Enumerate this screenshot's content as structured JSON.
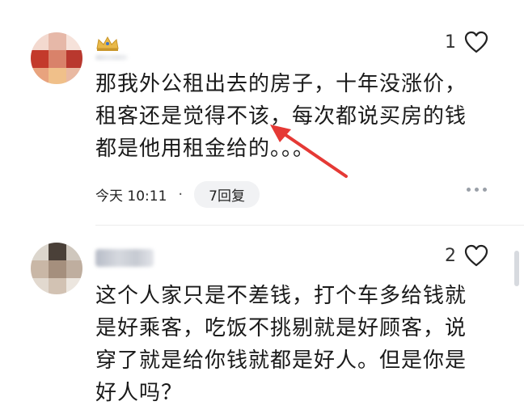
{
  "comments": [
    {
      "likes": "1",
      "text": "那我外公租出去的房子，十年没涨价，\n租客还是觉得不该，每次都说买房的钱\n都是他用租金给的。。。",
      "time": "今天 10:11",
      "replies": "7回复"
    },
    {
      "likes": "2",
      "text": "这个人家只是不差钱，打个车多给钱就\n是好乘客，吃饭不挑剔就是好顾客，说\n穿了就是给你钱就都是好人。但是你是\n好人吗？"
    }
  ],
  "icons": {
    "like": "heart-outline-icon",
    "badge": "crown-badge-icon",
    "more": "more-dots-icon",
    "annotation": "red-arrow-annotation"
  },
  "colors": {
    "text": "#1a1a1a",
    "meta_bg": "#f1f2f4",
    "annotation_red": "#e53935"
  }
}
